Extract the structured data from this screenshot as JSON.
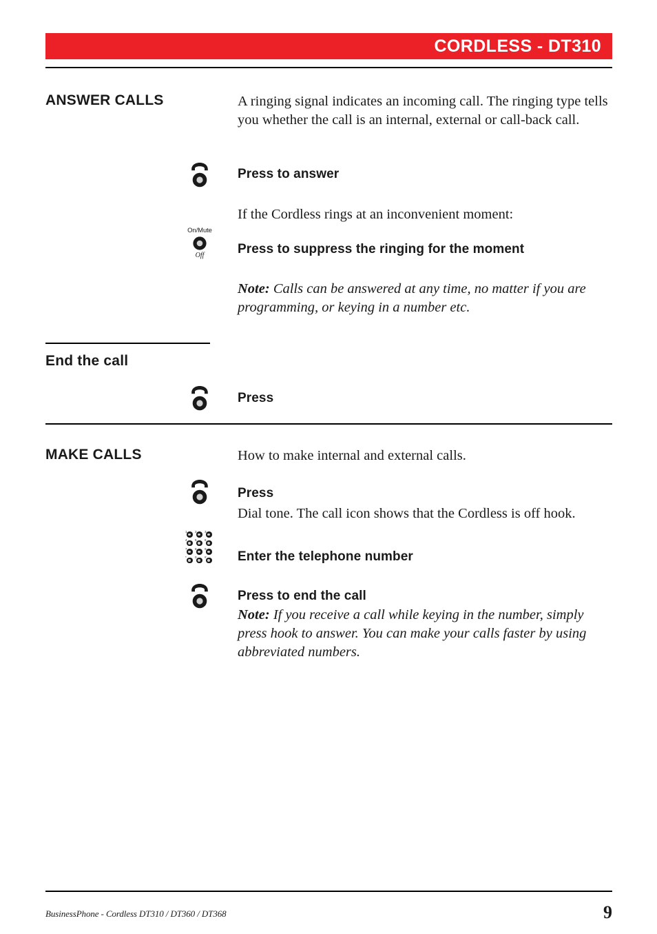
{
  "header": {
    "title": "CORDLESS - DT310",
    "accent_color": "#EC2027"
  },
  "sections": {
    "answer_calls": {
      "title": "ANSWER CALLS",
      "intro": "A ringing signal indicates an incoming call. The ringing type tells you whether the call is an internal, external or call-back call.",
      "step1_label": "Press to answer",
      "step1_icon": "hook-button-icon",
      "mid_text": "If the Cordless rings at an inconvenient moment:",
      "step2_label": "Press to suppress the ringing for the moment",
      "step2_icon": "mute-button-icon",
      "note_prefix": "Note:",
      "note_text": " Calls can be answered at any time, no matter if you are programming, or keying in a number etc."
    },
    "end_the_call": {
      "title": "End the call",
      "step1_label": "Press",
      "step1_icon": "hook-button-icon"
    },
    "make_calls": {
      "title": "MAKE CALLS",
      "intro": "How to make internal and external calls.",
      "step1_label": "Press",
      "step1_icon": "hook-button-icon",
      "step1_sub": "Dial tone. The call icon shows that the Cordless is off hook.",
      "step2_label": "Enter the telephone number",
      "step2_icon": "keypad-icon",
      "step3_label": "Press to end the call",
      "step3_icon": "hook-button-icon",
      "note_prefix": "Note:",
      "note_text": " If you receive a call while keying in the number, simply press hook to answer. You can make your calls faster by using abbreviated numbers."
    }
  },
  "icons": {
    "mute": {
      "top_label": "On/Mute",
      "bottom_label": "Off"
    },
    "keypad": {
      "keys": [
        {
          "num": "1",
          "alpha": ""
        },
        {
          "num": "2",
          "alpha": ""
        },
        {
          "num": "3",
          "alpha": ""
        },
        {
          "num": "4",
          "alpha": ""
        },
        {
          "num": "5",
          "alpha": ""
        },
        {
          "num": "6",
          "alpha": ""
        },
        {
          "num": "7",
          "alpha": ""
        },
        {
          "num": "8",
          "alpha": ""
        },
        {
          "num": "9",
          "alpha": ""
        },
        {
          "num": "*",
          "alpha": ""
        },
        {
          "num": "0",
          "alpha": ""
        },
        {
          "num": "#",
          "alpha": ""
        }
      ]
    }
  },
  "footer": {
    "text": "BusinessPhone - Cordless DT310 / DT360 / DT368",
    "page_number": "9"
  }
}
